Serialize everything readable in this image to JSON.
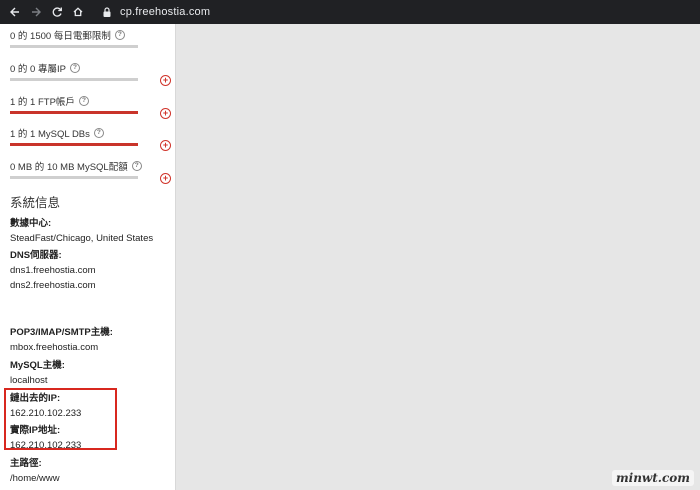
{
  "browser": {
    "url": "cp.freehostia.com"
  },
  "stats": [
    {
      "label": "0 的 1500 每日電郵限制",
      "fill": 0.0,
      "add": false
    },
    {
      "label": "0 的 0 專屬IP",
      "fill": 0.0,
      "add": true
    },
    {
      "label": "1 的 1 FTP帳戶",
      "fill": 1.0,
      "add": true
    },
    {
      "label": "1 的 1 MySQL DBs",
      "fill": 1.0,
      "add": true
    },
    {
      "label": "0 MB 的 10 MB MySQL配額",
      "fill": 0.0,
      "add": true
    }
  ],
  "system_info": {
    "title": "系統信息",
    "datacenter_label": "數據中心:",
    "datacenter_value": "SteadFast/Chicago, United States",
    "dns_label": "DNS伺服器:",
    "dns1": "dns1.freehostia.com",
    "dns2": "dns2.freehostia.com",
    "mail_label": "POP3/IMAP/SMTP主機:",
    "mail_value": "mbox.freehostia.com",
    "mysql_label": "MySQL主機:",
    "mysql_value": "localhost",
    "outgoing_ip_label": "鏈出去的IP:",
    "outgoing_ip_value": "162.210.102.233",
    "real_ip_label": "實際IP地址:",
    "real_ip_value": "162.210.102.233",
    "home_path_label": "主路徑:",
    "home_path_value": "/home/www"
  },
  "watermark": "minwt.com",
  "colors": {
    "accent": "#c9342a",
    "highlight": "#d8281f",
    "chrome_bg": "#202124"
  }
}
